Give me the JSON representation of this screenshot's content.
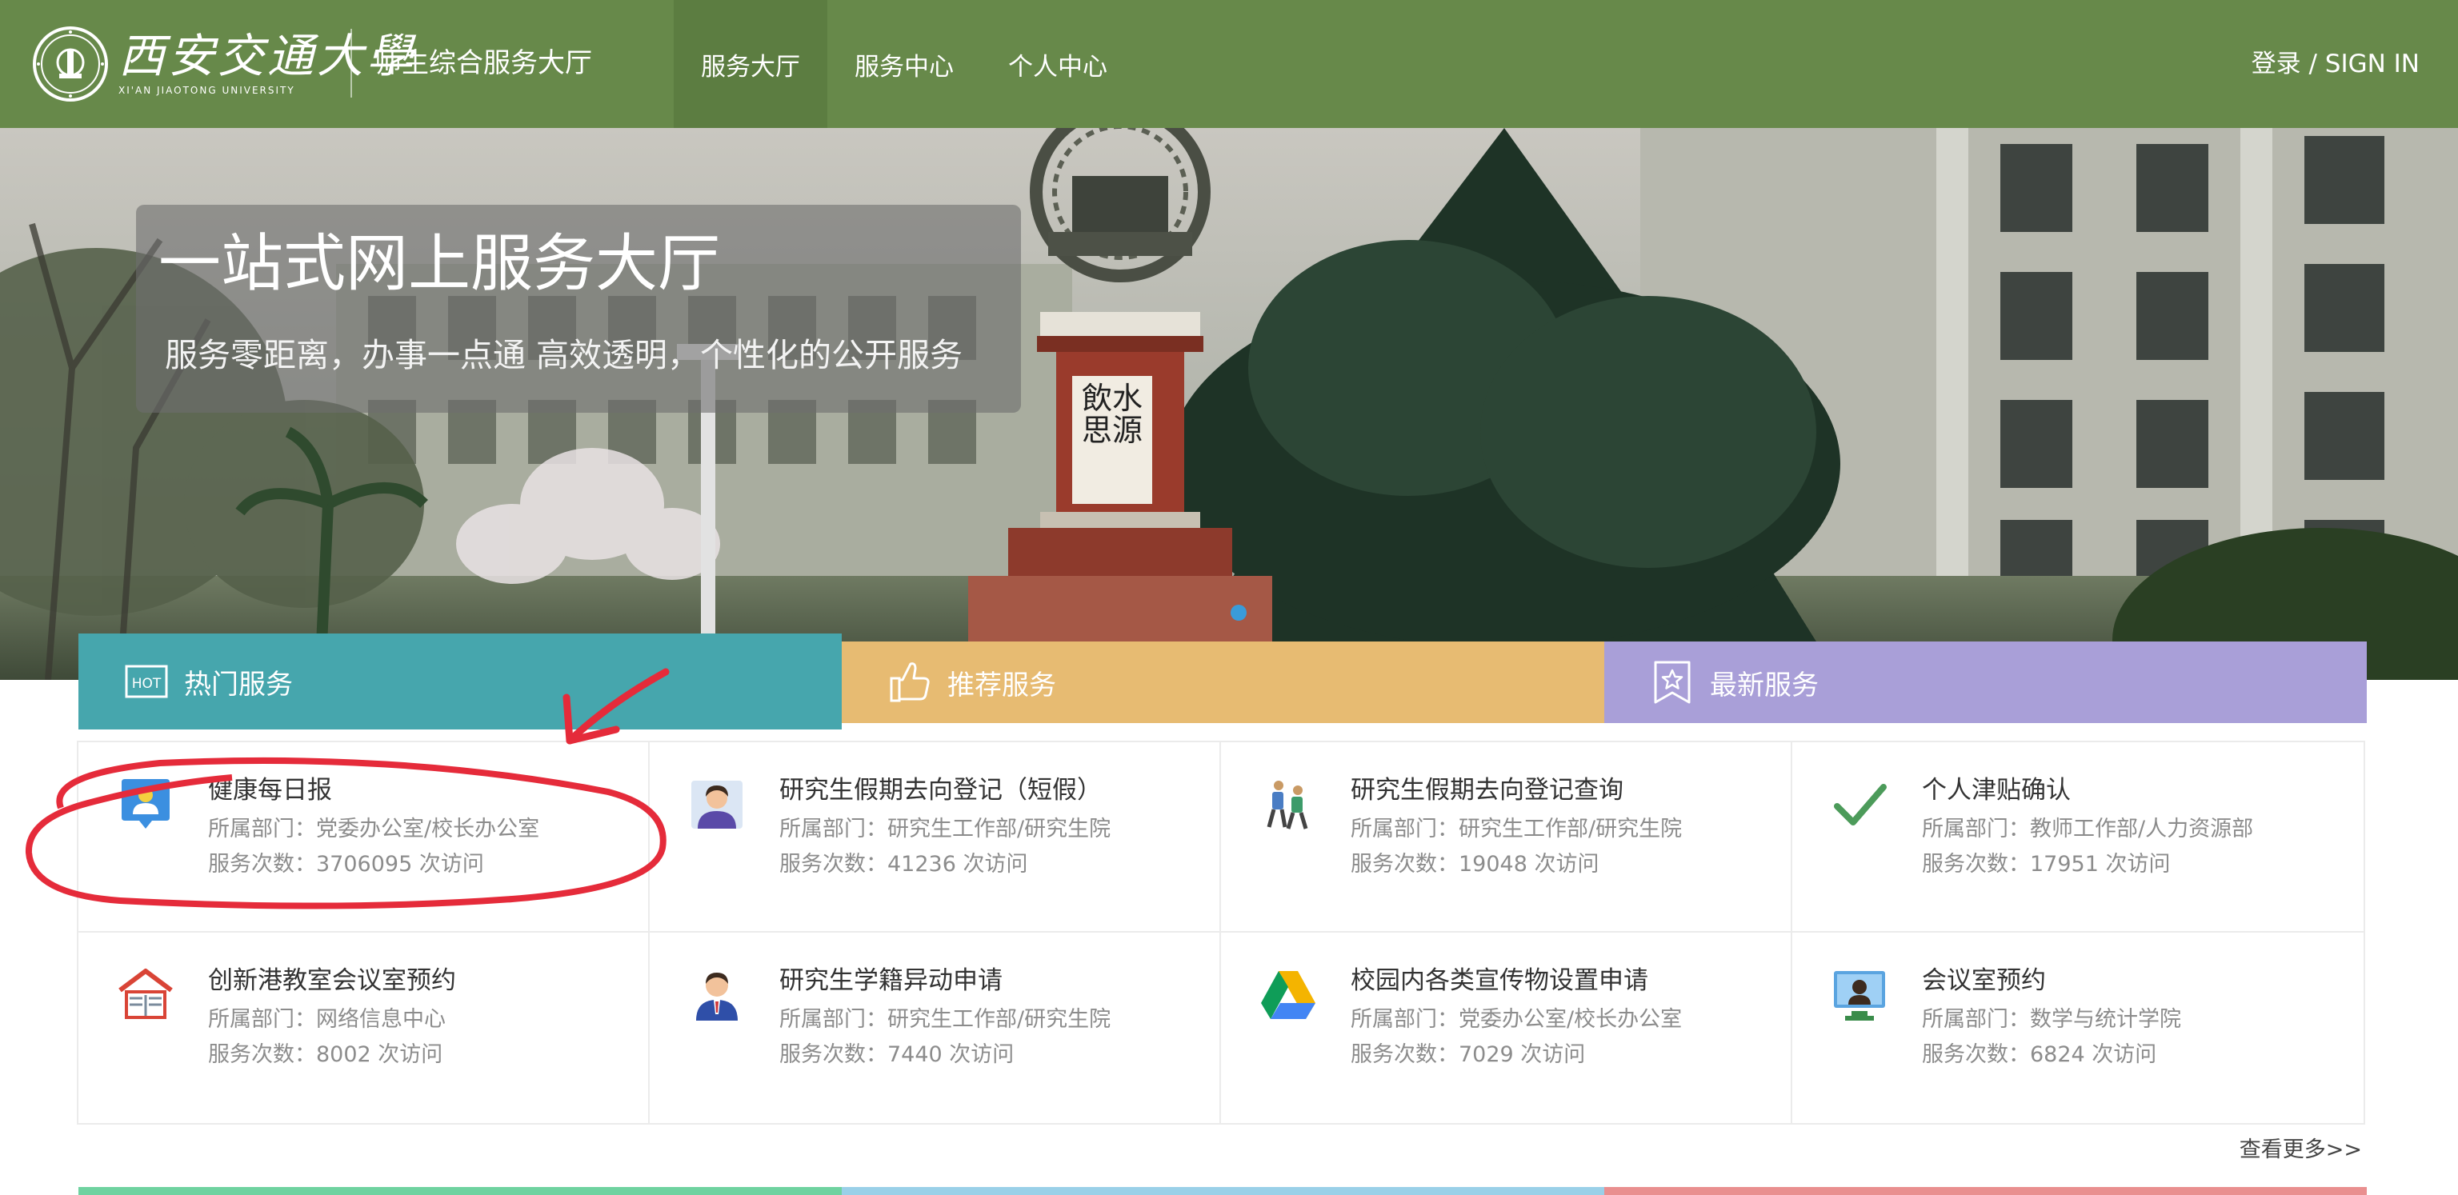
{
  "header": {
    "logo_cn": "西安交通大學",
    "logo_en": "XI'AN JIAOTONG UNIVERSITY",
    "site_title": "师生综合服务大厅",
    "nav": [
      {
        "label": "服务大厅",
        "active": true
      },
      {
        "label": "服务中心",
        "active": false
      },
      {
        "label": "个人中心",
        "active": false
      }
    ],
    "login": "登录 / SIGN IN",
    "bg_color": "#67894a"
  },
  "banner": {
    "title": "一站式网上服务大厅",
    "subtitle": "服务零距离，办事一点通 高效透明，个性化的公开服务",
    "monument_text": "飲水思源"
  },
  "tabs": [
    {
      "label": "热门服务",
      "icon": "hot-icon",
      "color": "#46a6ad"
    },
    {
      "label": "推荐服务",
      "icon": "thumbs-up-icon",
      "color": "#e7bb72"
    },
    {
      "label": "最新服务",
      "icon": "star-bookmark-icon",
      "color": "#a99fd8"
    }
  ],
  "hot_icon_text": "HOT",
  "services": [
    {
      "title": "健康每日报",
      "dept": "所属部门：党委办公室/校长办公室",
      "count": "服务次数：3706095 次访问",
      "icon": "person-badge-icon"
    },
    {
      "title": "研究生假期去向登记（短假）",
      "dept": "所属部门：研究生工作部/研究生院",
      "count": "服务次数：41236 次访问",
      "icon": "student-avatar-icon"
    },
    {
      "title": "研究生假期去向登记查询",
      "dept": "所属部门：研究生工作部/研究生院",
      "count": "服务次数：19048 次访问",
      "icon": "hikers-icon"
    },
    {
      "title": "个人津贴确认",
      "dept": "所属部门：教师工作部/人力资源部",
      "count": "服务次数：17951 次访问",
      "icon": "checkmark-icon"
    },
    {
      "title": "创新港教室会议室预约",
      "dept": "所属部门：网络信息中心",
      "count": "服务次数：8002 次访问",
      "icon": "classroom-book-icon"
    },
    {
      "title": "研究生学籍异动申请",
      "dept": "所属部门：研究生工作部/研究生院",
      "count": "服务次数：7440 次访问",
      "icon": "businessman-avatar-icon"
    },
    {
      "title": "校园内各类宣传物设置申请",
      "dept": "所属部门：党委办公室/校长办公室",
      "count": "服务次数：7029 次访问",
      "icon": "triangle-drive-icon"
    },
    {
      "title": "会议室预约",
      "dept": "所属部门：数学与统计学院",
      "count": "服务次数：6824 次访问",
      "icon": "monitor-person-icon"
    }
  ],
  "more": "查看更多>>",
  "annotation_color": "#e52b3a"
}
